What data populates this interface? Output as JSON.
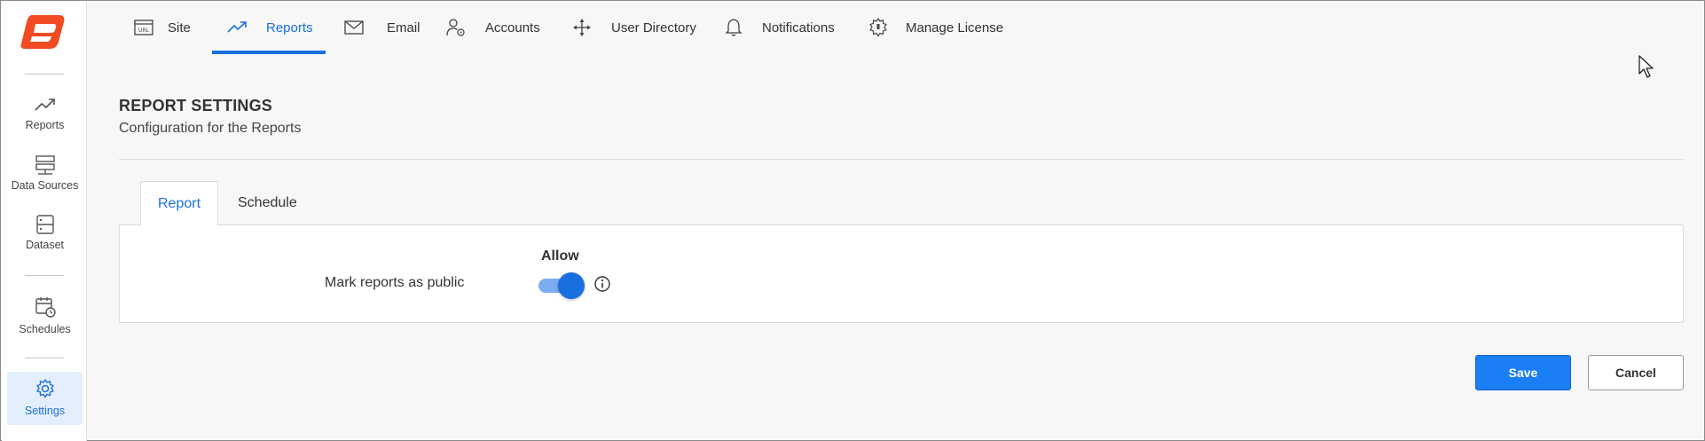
{
  "sidebar": {
    "items": [
      {
        "label": "Reports",
        "icon": "trending-up-icon"
      },
      {
        "label": "Data Sources",
        "icon": "server-icon"
      },
      {
        "label": "Dataset",
        "icon": "dataset-icon"
      },
      {
        "label": "Schedules",
        "icon": "calendar-clock-icon"
      },
      {
        "label": "Settings",
        "icon": "gear-icon",
        "active": true
      }
    ]
  },
  "topnav": {
    "tabs": [
      {
        "label": "Site",
        "icon": "url-icon"
      },
      {
        "label": "Reports",
        "icon": "trending-up-icon",
        "active": true
      },
      {
        "label": "Email",
        "icon": "envelope-icon"
      },
      {
        "label": "Accounts",
        "icon": "user-gear-icon"
      },
      {
        "label": "User Directory",
        "icon": "directory-icon"
      },
      {
        "label": "Notifications",
        "icon": "bell-icon"
      },
      {
        "label": "Manage License",
        "icon": "license-gear-icon"
      }
    ]
  },
  "page": {
    "title": "REPORT SETTINGS",
    "subtitle": "Configuration for the Reports"
  },
  "inner_tabs": [
    {
      "label": "Report",
      "active": true
    },
    {
      "label": "Schedule"
    }
  ],
  "form": {
    "field_label": "Mark reports as public",
    "column_header": "Allow",
    "toggle_on": true
  },
  "buttons": {
    "save": "Save",
    "cancel": "Cancel"
  },
  "colors": {
    "accent": "#1a6fe0",
    "logo": "#f25022"
  }
}
